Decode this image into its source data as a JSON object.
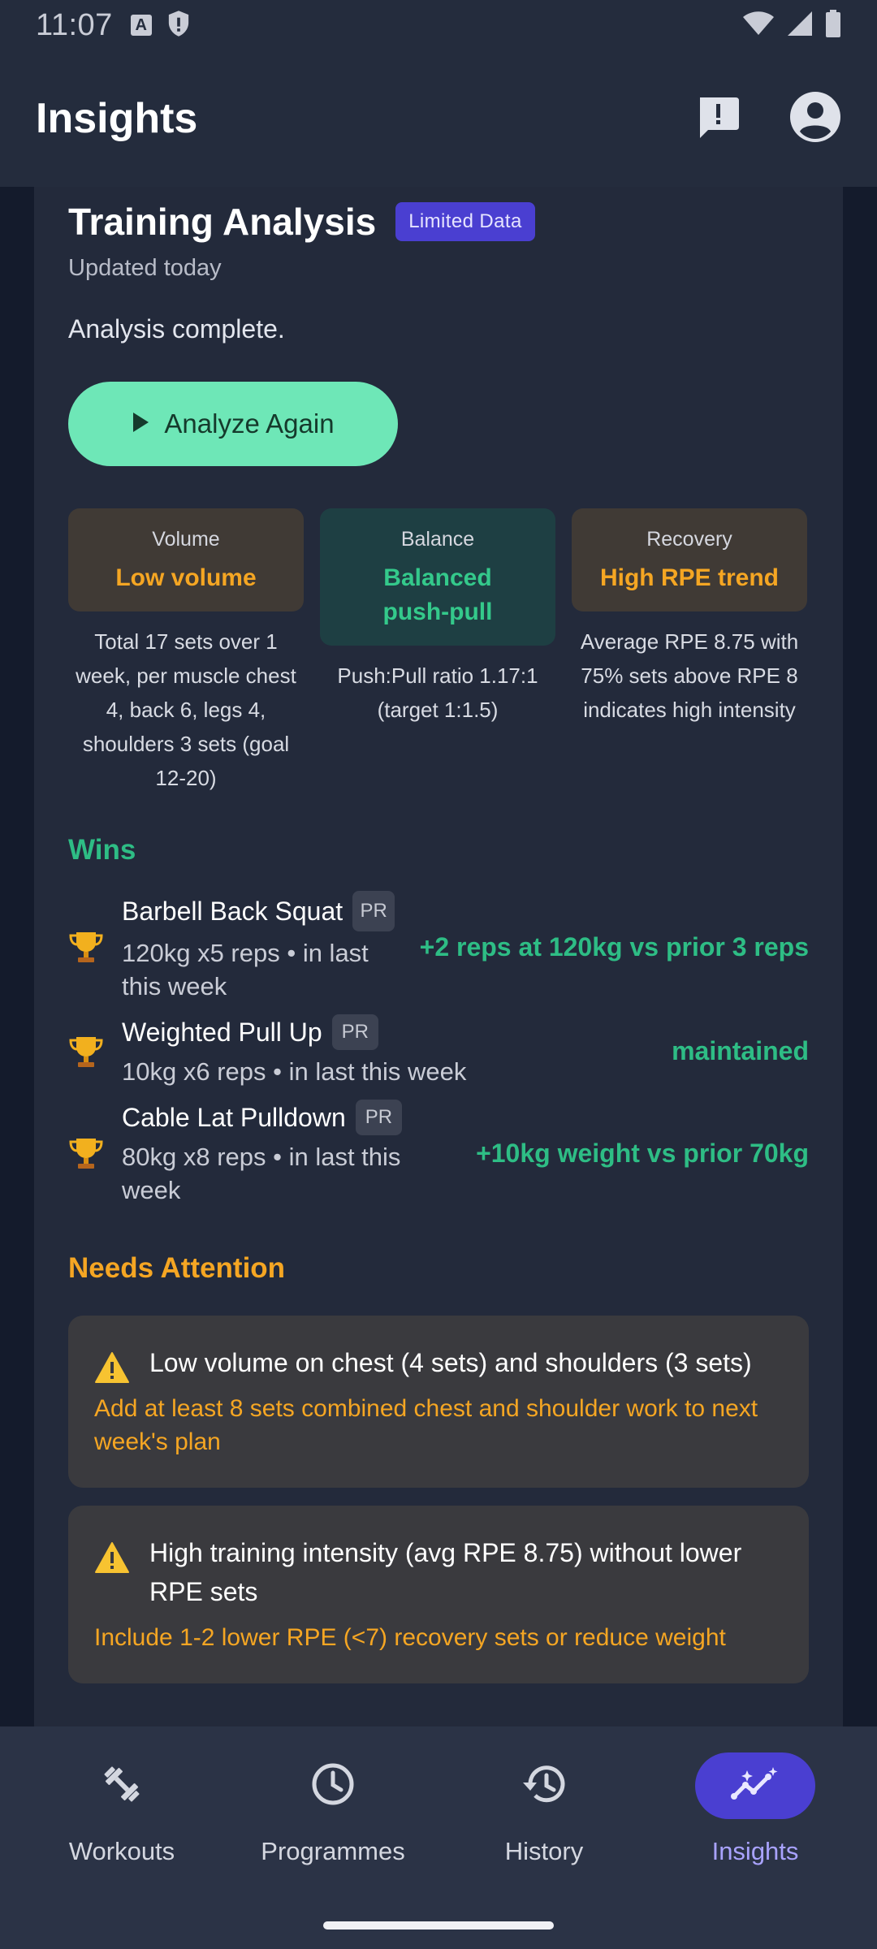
{
  "status_bar": {
    "time": "11:07"
  },
  "app_bar": {
    "title": "Insights"
  },
  "analysis": {
    "title": "Training Analysis",
    "badge": "Limited Data",
    "updated": "Updated today",
    "status": "Analysis complete.",
    "analyze_button": "Analyze Again"
  },
  "metrics": [
    {
      "label": "Volume",
      "value": "Low volume",
      "desc": "Total 17 sets over 1 week, per muscle chest 4, back 6, legs 4, shoulders 3 sets (goal 12-20)",
      "tone": "amber"
    },
    {
      "label": "Balance",
      "value": "Balanced push-pull",
      "desc": "Push:Pull ratio 1.17:1 (target 1:1.5)",
      "tone": "green"
    },
    {
      "label": "Recovery",
      "value": "High RPE trend",
      "desc": "Average RPE 8.75 with 75% sets above RPE 8 indicates high intensity",
      "tone": "amber"
    }
  ],
  "wins": {
    "title": "Wins",
    "items": [
      {
        "name": "Barbell Back Squat",
        "badge": "PR",
        "detail": "120kg x5 reps • in last this week",
        "delta": "+2 reps at 120kg vs prior 3 reps"
      },
      {
        "name": "Weighted Pull Up",
        "badge": "PR",
        "detail": "10kg x6 reps • in last this week",
        "delta": "maintained"
      },
      {
        "name": "Cable Lat Pulldown",
        "badge": "PR",
        "detail": "80kg x8 reps • in last this week",
        "delta": "+10kg weight vs prior 70kg"
      }
    ]
  },
  "attention": {
    "title": "Needs Attention",
    "items": [
      {
        "title": "Low volume on chest (4 sets) and shoulders (3 sets)",
        "action": "Add at least 8 sets combined chest and shoulder work to next week's plan"
      },
      {
        "title": "High training intensity (avg RPE 8.75) without lower RPE sets",
        "action": "Include 1-2 lower RPE (<7) recovery sets or reduce weight"
      }
    ]
  },
  "bottom_nav": [
    {
      "label": "Workouts",
      "icon": "dumbbell-icon",
      "active": false
    },
    {
      "label": "Programmes",
      "icon": "clock-icon",
      "active": false
    },
    {
      "label": "History",
      "icon": "history-icon",
      "active": false
    },
    {
      "label": "Insights",
      "icon": "insights-icon",
      "active": true
    }
  ],
  "colors": {
    "accent": "#4a3fd1",
    "win_green": "#2ebd85",
    "warning_amber": "#f5a623",
    "analyze_button": "#6ee7b7"
  }
}
